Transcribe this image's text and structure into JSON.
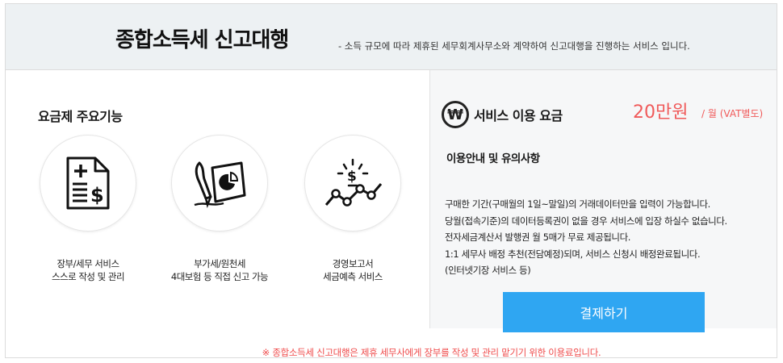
{
  "header": {
    "title": "종합소득세 신고대행",
    "subtitle": "- 소득 규모에 따라 제휴된 세무회계사무소와 계약하여 신고대행을 진행하는 서비스 입니다."
  },
  "features": {
    "title": "요금제 주요기능",
    "items": [
      {
        "icon": "document-dollar-icon",
        "line1": "장부/세무 서비스",
        "line2": "스스로 작성 및 관리"
      },
      {
        "icon": "pen-chart-icon",
        "line1": "부가세/원천세",
        "line2": "4대보험 등 직접 신고 가능"
      },
      {
        "icon": "trend-dollar-icon",
        "line1": "경영보고서",
        "line2": "세금예측 서비스"
      }
    ]
  },
  "pricing": {
    "won_symbol": "₩",
    "label": "서비스 이용 요금",
    "price": "20만원",
    "unit": "/ 월 (VAT별도)",
    "accent_color": "#f05a5a"
  },
  "notice": {
    "title": "이용안내 및 유의사항",
    "lines": [
      "구매한 기간(구매월의 1일~말일)의 거래데이터만을 입력이 가능합니다.",
      "당월(접속기준)의 데이터등록권이 없을 경우 서비스에 입장 하실수 없습니다.",
      "전자세금계산서 발행권 월 5매가 무료 제공됩니다.",
      "1:1 세무사 배정 추천(전담예정)되며, 서비스 신청시 배정완료됩니다.",
      "(인터넷기장 서비스 등)"
    ]
  },
  "pay_button": {
    "label": "결제하기",
    "color": "#2fa6f2"
  },
  "footnote": "※ 종합소득세 신고대행은 제휴 세무사에게 장부를 작성 및 관리 맡기기 위한 이용료입니다."
}
